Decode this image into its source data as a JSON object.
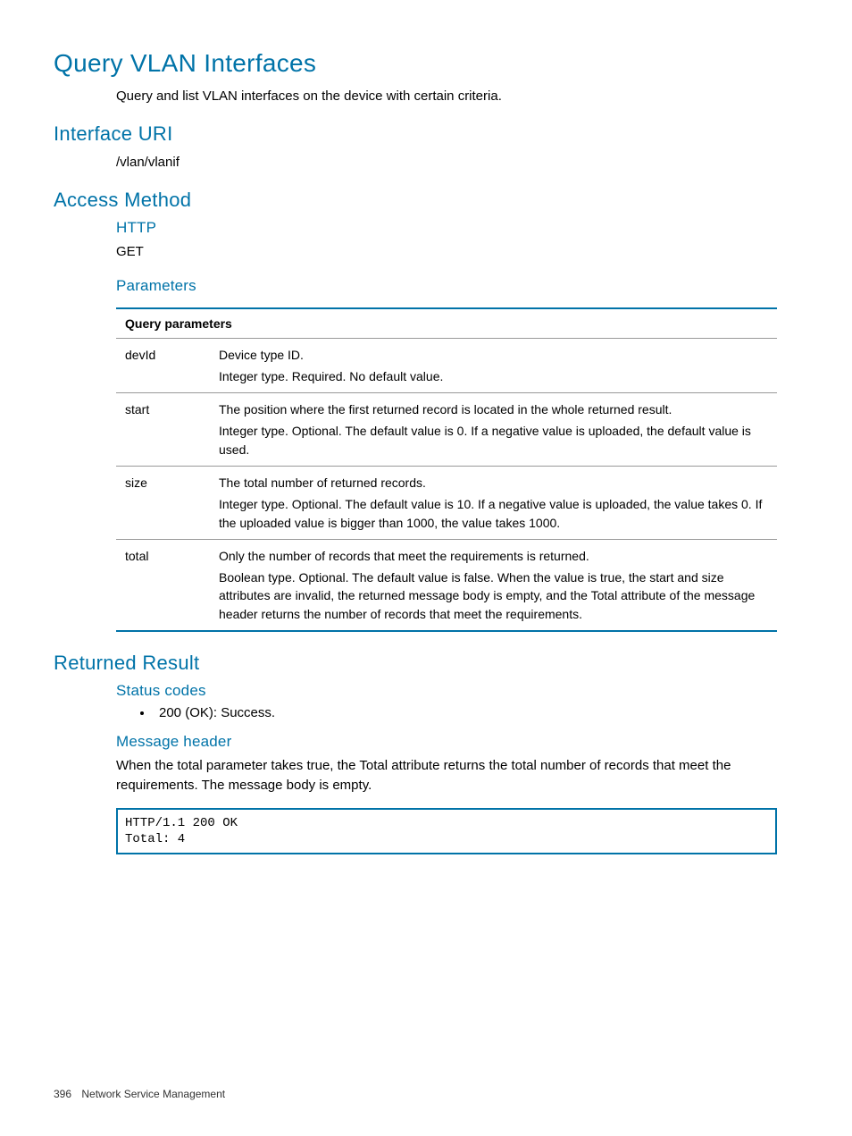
{
  "page": {
    "title": "Query VLAN Interfaces",
    "intro": "Query and list VLAN interfaces on the device with certain criteria."
  },
  "sections": {
    "interface_uri": {
      "heading": "Interface URI",
      "value": "/vlan/vlanif"
    },
    "access_method": {
      "heading": "Access Method",
      "http_heading": "HTTP",
      "http_value": "GET",
      "parameters_heading": "Parameters"
    },
    "returned_result": {
      "heading": "Returned Result",
      "status_codes_heading": "Status codes",
      "status_codes": {
        "item0": "200 (OK): Success."
      },
      "message_header_heading": "Message header",
      "message_header_text": "When the total parameter takes true, the Total attribute returns the total number of records that meet the requirements. The message body is empty.",
      "code": "HTTP/1.1 200 OK\nTotal: 4"
    }
  },
  "table": {
    "header": "Query parameters",
    "rows": [
      {
        "name": "devId",
        "desc1": "Device type ID.",
        "desc2": "Integer type. Required. No default value."
      },
      {
        "name": "start",
        "desc1": "The position where the first returned record is located in the whole returned result.",
        "desc2": "Integer type. Optional. The default value is 0. If a negative value is uploaded, the default value is used."
      },
      {
        "name": "size",
        "desc1": "The total number of returned records.",
        "desc2": "Integer type. Optional. The default value is 10. If a negative value is uploaded, the value takes 0. If the uploaded value is bigger than 1000, the value takes 1000."
      },
      {
        "name": "total",
        "desc1": "Only the number of records that meet the requirements is returned.",
        "desc2": "Boolean type. Optional. The default value is false. When the value is true, the start and size attributes are invalid, the returned message body is empty, and the Total attribute of the message header returns the number of records that meet the requirements."
      }
    ]
  },
  "footer": {
    "page_number": "396",
    "section": "Network Service Management"
  }
}
